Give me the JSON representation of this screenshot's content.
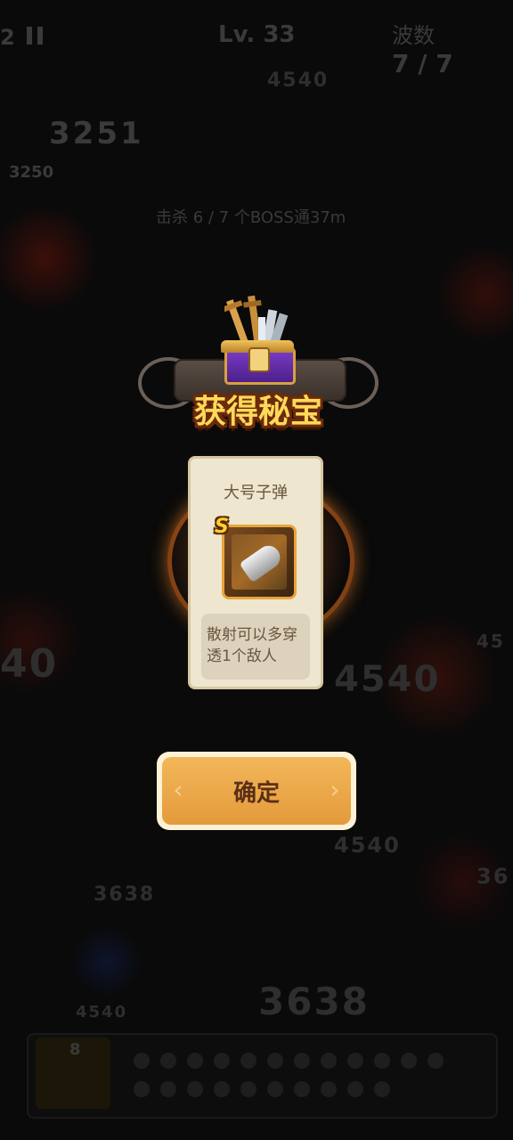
{
  "hud": {
    "stage_prefix": "2",
    "level": "Lv. 33",
    "wave_label": "波数",
    "wave_count": "7 / 7",
    "gold_big": "3251",
    "gold_small": "3250",
    "kill_info": "击杀 6 / 7 个BOSS通37m"
  },
  "damage_numbers": [
    "4540",
    "40",
    "4540",
    "4540",
    "3638",
    "3638",
    "4540",
    "45",
    "36"
  ],
  "bottom_bar": {
    "book_count": "8"
  },
  "reward_popup": {
    "title": "获得秘宝",
    "item_name": "大号子弹",
    "rank": "S",
    "description": "散射可以多穿透1个敌人",
    "confirm_label": "确定"
  },
  "colors": {
    "title_fill": "#ffd95a",
    "title_outline": "#6b2b0a",
    "card_bg": "#efe6cf",
    "button_fill": "#e49a3b",
    "glow": "#ff8c28"
  }
}
